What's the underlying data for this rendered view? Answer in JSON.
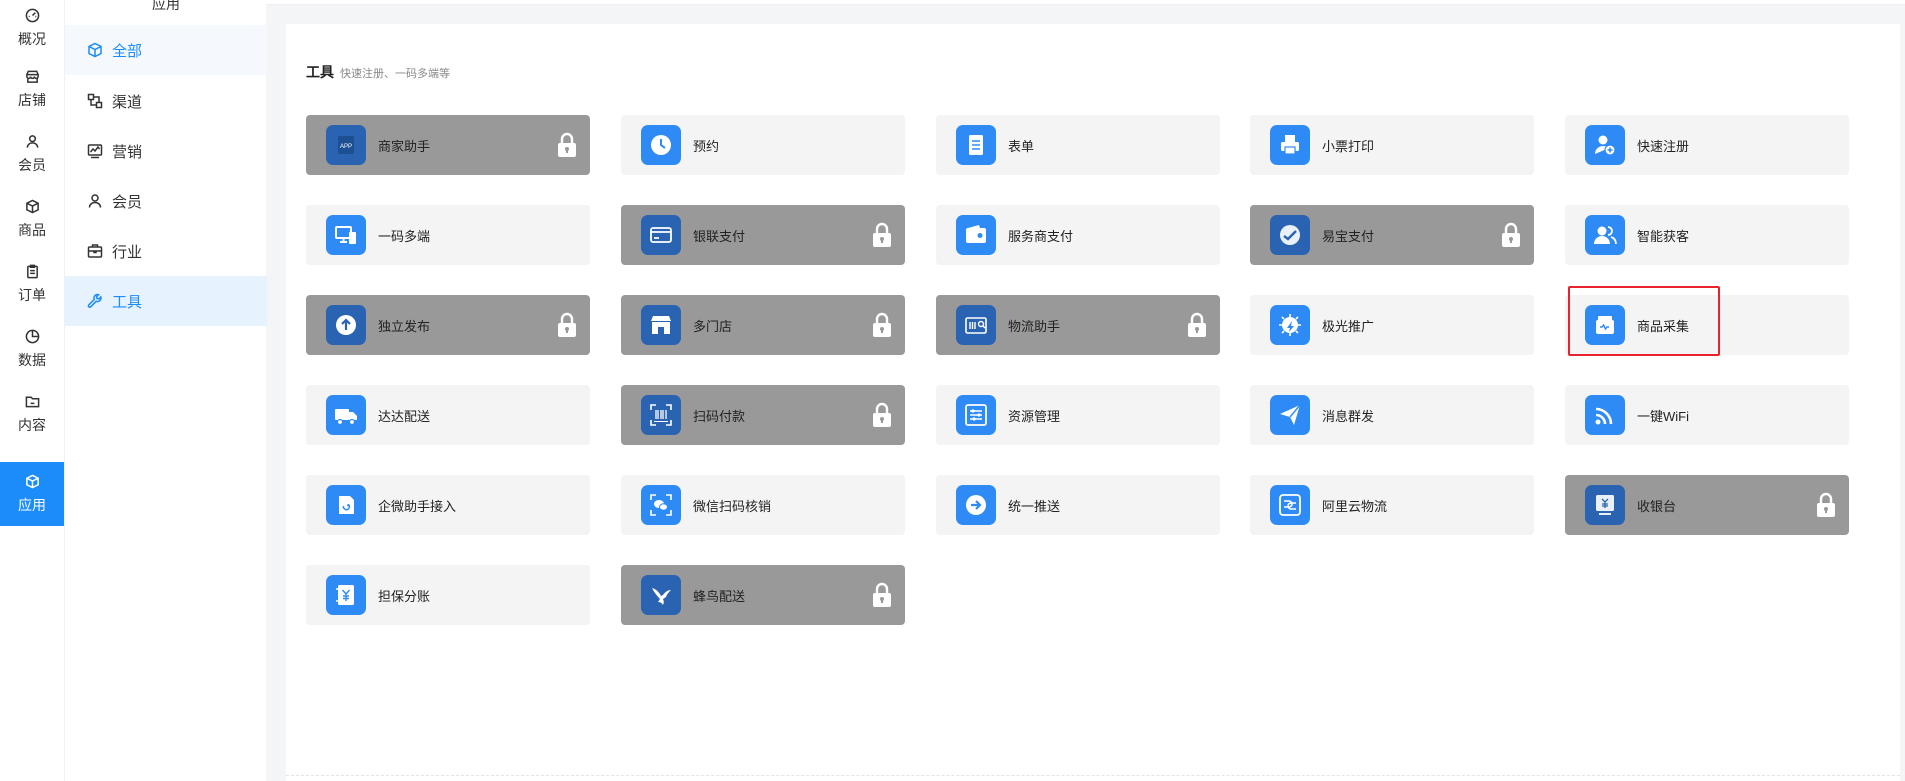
{
  "nav": {
    "items": [
      {
        "label": "概况",
        "icon": "dashboard-icon"
      },
      {
        "label": "店铺",
        "icon": "store-icon"
      },
      {
        "label": "会员",
        "icon": "user-icon"
      },
      {
        "label": "商品",
        "icon": "box-icon"
      },
      {
        "label": "订单",
        "icon": "clipboard-icon"
      },
      {
        "label": "数据",
        "icon": "pie-chart-icon"
      },
      {
        "label": "内容",
        "icon": "folder-icon"
      },
      {
        "label": "应用",
        "icon": "cube-icon",
        "active": true
      }
    ]
  },
  "sidebar": {
    "title": "应用",
    "items": [
      {
        "label": "全部",
        "icon": "cube-icon"
      },
      {
        "label": "渠道",
        "icon": "channel-icon"
      },
      {
        "label": "营销",
        "icon": "chart-line-icon"
      },
      {
        "label": "会员",
        "icon": "user-icon"
      },
      {
        "label": "行业",
        "icon": "briefcase-icon"
      },
      {
        "label": "工具",
        "icon": "wrench-icon",
        "active": true
      }
    ]
  },
  "section": {
    "title": "工具",
    "subtitle": "快速注册、一码多端等"
  },
  "tools": [
    {
      "label": "商家助手",
      "locked": true,
      "icon": "app-icon"
    },
    {
      "label": "预约",
      "locked": false,
      "icon": "clock-icon"
    },
    {
      "label": "表单",
      "locked": false,
      "icon": "document-icon"
    },
    {
      "label": "小票打印",
      "locked": false,
      "icon": "printer-icon"
    },
    {
      "label": "快速注册",
      "locked": false,
      "icon": "user-add-icon"
    },
    {
      "label": "一码多端",
      "locked": false,
      "icon": "devices-icon"
    },
    {
      "label": "银联支付",
      "locked": true,
      "icon": "card-icon"
    },
    {
      "label": "服务商支付",
      "locked": false,
      "icon": "wallet-icon"
    },
    {
      "label": "易宝支付",
      "locked": true,
      "icon": "yibao-icon"
    },
    {
      "label": "智能获客",
      "locked": false,
      "icon": "users-icon"
    },
    {
      "label": "独立发布",
      "locked": true,
      "icon": "upload-icon"
    },
    {
      "label": "多门店",
      "locked": true,
      "icon": "shop-icon"
    },
    {
      "label": "物流助手",
      "locked": true,
      "icon": "logistics-icon"
    },
    {
      "label": "极光推广",
      "locked": false,
      "icon": "aurora-icon"
    },
    {
      "label": "商品采集",
      "locked": false,
      "icon": "collect-icon"
    },
    {
      "label": "达达配送",
      "locked": false,
      "icon": "truck-icon"
    },
    {
      "label": "扫码付款",
      "locked": true,
      "icon": "barcode-icon"
    },
    {
      "label": "资源管理",
      "locked": false,
      "icon": "sliders-icon"
    },
    {
      "label": "消息群发",
      "locked": false,
      "icon": "send-icon"
    },
    {
      "label": "一键WiFi",
      "locked": false,
      "icon": "wifi-icon"
    },
    {
      "label": "企微助手接入",
      "locked": false,
      "icon": "wecom-icon"
    },
    {
      "label": "微信扫码核销",
      "locked": false,
      "icon": "wechat-scan-icon"
    },
    {
      "label": "统一推送",
      "locked": false,
      "icon": "arrow-circle-icon"
    },
    {
      "label": "阿里云物流",
      "locked": false,
      "icon": "aliyun-icon"
    },
    {
      "label": "收银台",
      "locked": true,
      "icon": "cashier-icon"
    },
    {
      "label": "担保分账",
      "locked": false,
      "icon": "yuan-icon"
    },
    {
      "label": "蜂鸟配送",
      "locked": true,
      "icon": "hummingbird-icon"
    }
  ],
  "highlighted_tool": "商品采集",
  "colors": {
    "accent": "#1b8cfa",
    "tile_icon": "#2e8bf6",
    "locked_tile": "#999999",
    "highlight": "#e8232b"
  }
}
